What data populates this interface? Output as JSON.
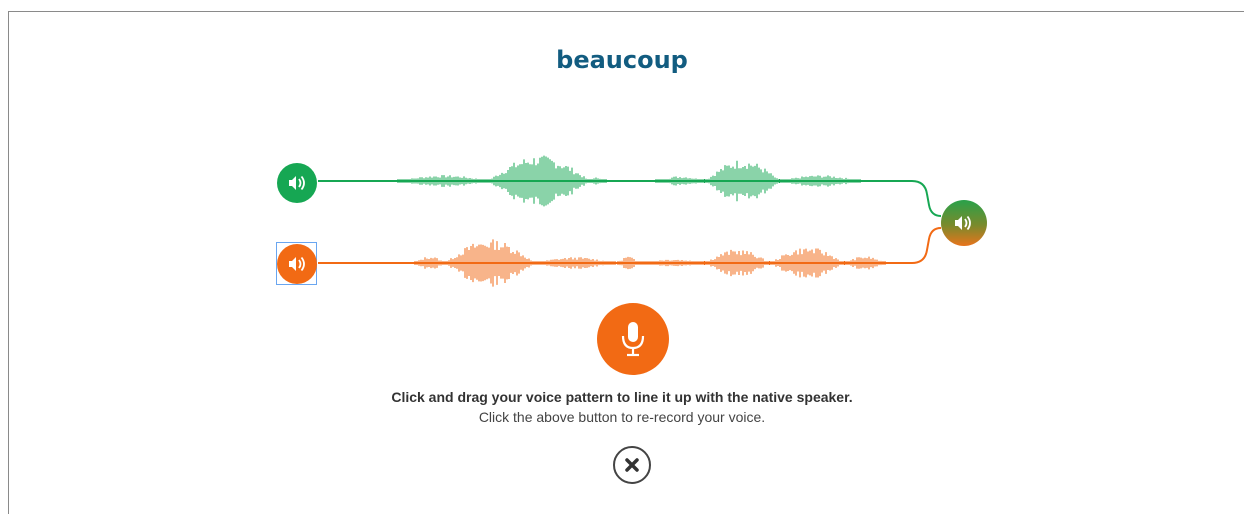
{
  "word": "beaucoup",
  "instructions": {
    "primary": "Click and drag your voice pattern to line it up with the native speaker.",
    "secondary": "Click the above button to re-record your voice."
  },
  "colors": {
    "title": "#125c80",
    "native": "#16a753",
    "user": "#f26a14",
    "text": "#333333"
  },
  "controls": {
    "native_play": "speaker-icon",
    "user_play": "speaker-icon",
    "compare_play": "speaker-icon",
    "record": "microphone-icon",
    "close": "close-icon"
  }
}
